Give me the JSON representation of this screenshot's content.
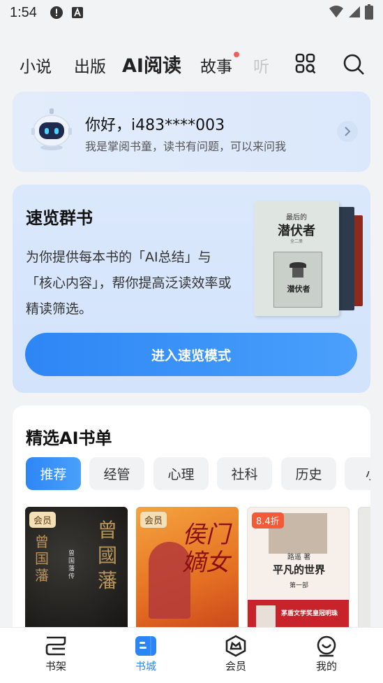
{
  "status": {
    "time": "1:54"
  },
  "nav": {
    "tabs": [
      {
        "label": "小说"
      },
      {
        "label": "出版"
      },
      {
        "label": "AI阅读"
      },
      {
        "label": "故事"
      },
      {
        "label": "听"
      }
    ],
    "icons": [
      "grid-search-icon",
      "search-icon"
    ]
  },
  "greeting": {
    "title": "你好，i483****003",
    "subtitle": "我是掌阅书童，读书有问题，可以来问我"
  },
  "speed_read": {
    "title": "速览群书",
    "desc": "为你提供每本书的「AI总结」与「核心内容」，帮你提高泛读效率或精读筛选。",
    "button": "进入速览模式",
    "cover": {
      "line1": "最后的",
      "line2": "潜伏者",
      "line3": "全二册",
      "line4": "潜伏者"
    }
  },
  "ai_list": {
    "title": "精选AI书单",
    "chips": [
      "推荐",
      "经管",
      "心理",
      "社科",
      "历史",
      "小"
    ],
    "books": [
      {
        "badge": "会员",
        "cover_text": "曾國藩",
        "author": "曾国藩传",
        "spine": "曾国藩"
      },
      {
        "badge": "会员",
        "cover_text": "侯门嫡女"
      },
      {
        "badge": "8.4折",
        "author": "路遥 著",
        "title": "平凡的世界",
        "volume": "第一部",
        "banner": "茅盾文学奖皇冠明珠"
      }
    ]
  },
  "bottom_nav": [
    {
      "label": "书架"
    },
    {
      "label": "书城"
    },
    {
      "label": "会员"
    },
    {
      "label": "我的"
    }
  ],
  "colors": {
    "accent": "#2b86f5",
    "notify_dot": "#f0605a"
  }
}
